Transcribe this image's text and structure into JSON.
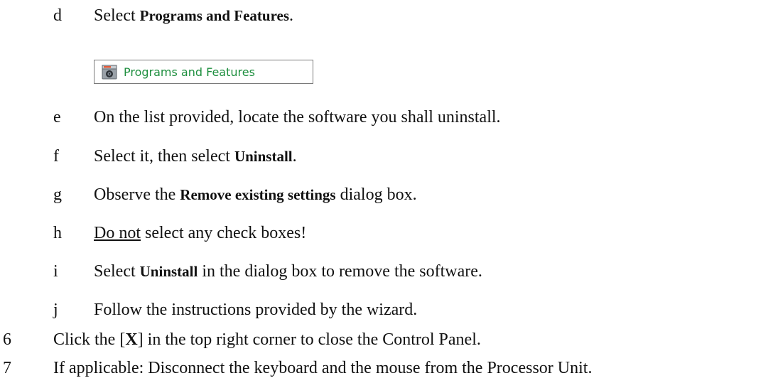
{
  "steps": [
    {
      "marker": "d",
      "pre": "Select ",
      "term": "Programs and Features",
      "post": "."
    },
    {
      "marker": "e",
      "text": "On the list provided, locate the software you shall uninstall."
    },
    {
      "marker": "f",
      "pre": "Select it, then select ",
      "term": "Uninstall",
      "post": "."
    },
    {
      "marker": "g",
      "pre": "Observe the ",
      "term": "Remove existing settings",
      "post": " dialog box."
    },
    {
      "marker": "h",
      "underlined": "Do not",
      "post": " select any check boxes!"
    },
    {
      "marker": "i",
      "pre": "Select ",
      "term": "Uninstall",
      "post": " in the dialog box to remove the software."
    },
    {
      "marker": "j",
      "text": "Follow the instructions provided by the wizard."
    },
    {
      "marker": "6",
      "pre": "Click the [",
      "key": "X",
      "post": "] in the top right corner to close the Control Panel."
    },
    {
      "marker": "7",
      "text": "If applicable: Disconnect the keyboard and the mouse from the Processor Unit."
    }
  ],
  "control_panel_entry": {
    "label": "Programs and Features",
    "icon": "programs-and-features-icon",
    "text_color": "#1e8f3f"
  }
}
